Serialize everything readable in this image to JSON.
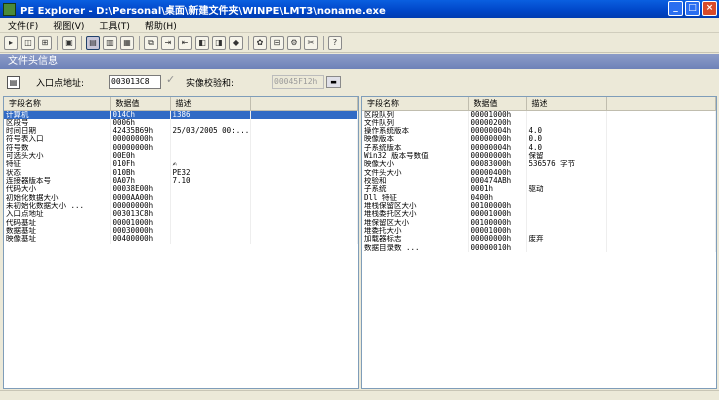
{
  "window": {
    "title": "PE Explorer - D:\\Personal\\桌面\\新建文件夹\\WINPE\\LMT3\\noname.exe",
    "controls": [
      "_",
      "□",
      "×"
    ]
  },
  "menu": [
    {
      "label": "文件(F)"
    },
    {
      "label": "视图(V)"
    },
    {
      "label": "工具(T)"
    },
    {
      "label": "帮助(H)"
    }
  ],
  "toolbar": {
    "buttons": [
      "open-icon",
      "save-icon",
      "print-icon",
      "disk-icon",
      "headers-icon",
      "data-directories-icon",
      "section-headers-icon",
      "resource-icon",
      "export-icon",
      "import-icon",
      "debug-icon",
      "dependency-icon",
      "disasm-icon",
      "plugin-icon",
      "resource-editor-icon",
      "syntax-icon",
      "hex-icon",
      "help-icon"
    ]
  },
  "section": {
    "title": "文件头信息"
  },
  "fields": {
    "entry_label": "入口点地址:",
    "entry_value": "003013C8",
    "checksum_label": "实像校验和:",
    "checksum_value": "00045F12h"
  },
  "columns": {
    "name": "字段名称",
    "value": "数据值",
    "desc": "描述"
  },
  "left_rows": [
    {
      "name": "计算机",
      "value": "014Ch",
      "desc": "i386",
      "selected": true
    },
    {
      "name": "区段号",
      "value": "0006h",
      "desc": ""
    },
    {
      "name": "时间日期",
      "value": "42435B69h",
      "desc": "25/03/2005  00:..."
    },
    {
      "name": "符号表入口",
      "value": "00000000h",
      "desc": ""
    },
    {
      "name": "符号数",
      "value": "00000000h",
      "desc": ""
    },
    {
      "name": "可选头大小",
      "value": "00E0h",
      "desc": ""
    },
    {
      "name": "特征",
      "value": "010Fh",
      "desc": "✍"
    },
    {
      "name": "状态",
      "value": "010Bh",
      "desc": "PE32"
    },
    {
      "name": "连接器版本号",
      "value": "0A07h",
      "desc": "7.10"
    },
    {
      "name": "代码大小",
      "value": "00038E00h",
      "desc": ""
    },
    {
      "name": "初始化数据大小",
      "value": "0000AA00h",
      "desc": ""
    },
    {
      "name": "未初始化数据大小          ...",
      "value": "00000000h",
      "desc": ""
    },
    {
      "name": "入口点地址",
      "value": "003013C8h",
      "desc": ""
    },
    {
      "name": "代码基址",
      "value": "00001000h",
      "desc": ""
    },
    {
      "name": "数据基址",
      "value": "00030000h",
      "desc": ""
    },
    {
      "name": "映像基址",
      "value": "00400000h",
      "desc": ""
    }
  ],
  "right_rows": [
    {
      "name": "区段队列",
      "value": "00001000h",
      "desc": ""
    },
    {
      "name": "文件队列",
      "value": "00000200h",
      "desc": ""
    },
    {
      "name": "操作系统版本",
      "value": "00000004h",
      "desc": "4.0"
    },
    {
      "name": "映像版本",
      "value": "00000000h",
      "desc": "0.0"
    },
    {
      "name": "子系统版本",
      "value": "00000004h",
      "desc": "4.0"
    },
    {
      "name": "Win32 版本号数值",
      "value": "00000000h",
      "desc": "保留"
    },
    {
      "name": "映像大小",
      "value": "00083000h",
      "desc": "536576 字节"
    },
    {
      "name": "文件头大小",
      "value": "00000400h",
      "desc": ""
    },
    {
      "name": "校验和",
      "value": "000474ABh",
      "desc": ""
    },
    {
      "name": "子系统",
      "value": "0001h",
      "desc": "驱动"
    },
    {
      "name": "Dll 特征",
      "value": "0400h",
      "desc": ""
    },
    {
      "name": "堆栈保留区大小",
      "value": "00100000h",
      "desc": ""
    },
    {
      "name": "堆栈委托区大小",
      "value": "00001000h",
      "desc": ""
    },
    {
      "name": "堆保留区大小",
      "value": "00100000h",
      "desc": ""
    },
    {
      "name": "堆委托大小",
      "value": "00001000h",
      "desc": ""
    },
    {
      "name": "加载器标志",
      "value": "00000000h",
      "desc": "废弃"
    },
    {
      "name": "数据目录数        ...",
      "value": "00000010h",
      "desc": ""
    }
  ]
}
